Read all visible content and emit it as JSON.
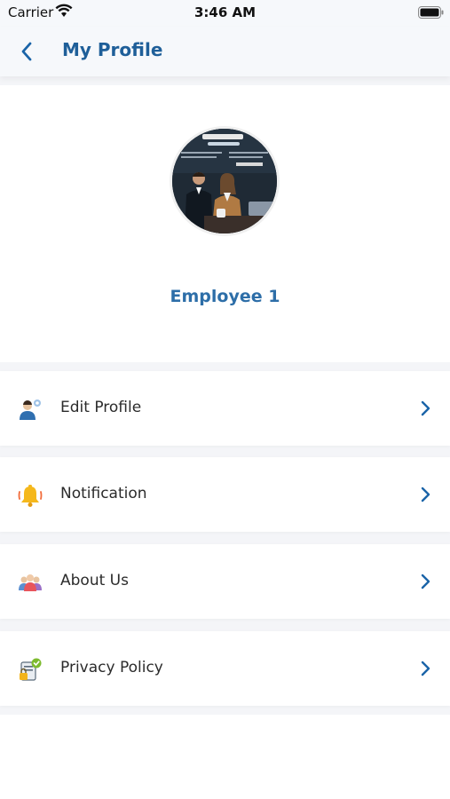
{
  "status_bar": {
    "carrier": "Carrier",
    "time": "3:46 AM"
  },
  "nav": {
    "title": "My Profile"
  },
  "profile": {
    "name": "Employee 1"
  },
  "menu": {
    "items": [
      {
        "label": "Edit Profile",
        "icon": "user-edit-icon"
      },
      {
        "label": "Notification",
        "icon": "bell-icon"
      },
      {
        "label": "About Us",
        "icon": "team-icon"
      },
      {
        "label": "Privacy Policy",
        "icon": "privacy-icon"
      }
    ]
  },
  "colors": {
    "accent": "#1f5f99",
    "name": "#2d6ea8",
    "chevron": "#1a64a8"
  }
}
